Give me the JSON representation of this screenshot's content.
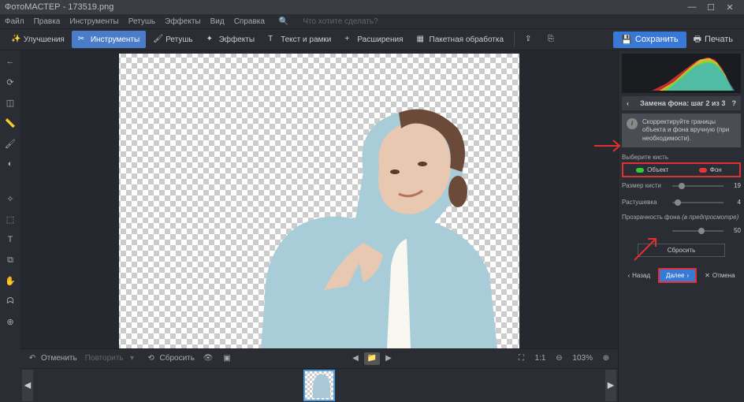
{
  "titlebar": {
    "app": "ФотоМАСТЕР",
    "file": "173519.png"
  },
  "menubar": {
    "items": [
      "Файл",
      "Правка",
      "Инструменты",
      "Ретушь",
      "Эффекты",
      "Вид",
      "Справка"
    ],
    "search_placeholder": "Что хотите сделать?"
  },
  "toolbar": {
    "enhance": "Улучшения",
    "tools": "Инструменты",
    "retouch": "Ретушь",
    "effects": "Эффекты",
    "text": "Текст и рамки",
    "ext": "Расширения",
    "batch": "Пакетная обработка",
    "save": "Сохранить",
    "print": "Печать"
  },
  "bottombar": {
    "undo": "Отменить",
    "redo": "Повторить",
    "reset": "Сбросить",
    "zoom": "103%",
    "ratio": "1:1"
  },
  "panel": {
    "title": "Замена фона: шаг 2 из 3",
    "hint": "Скорректируйте границы объекта и фона вручную (при необходимости).",
    "brush_label": "Выберите кисть",
    "object": "Объект",
    "background": "Фон",
    "size_label": "Размер кисти",
    "size_val": "19",
    "feather_label": "Растушевка",
    "feather_val": "4",
    "opacity_label": "Прозрачность фона",
    "opacity_hint": "(в предпросмотре)",
    "opacity_val": "50",
    "reset": "Сбросить",
    "back": "Назад",
    "next": "Далее",
    "cancel": "Отмена"
  }
}
